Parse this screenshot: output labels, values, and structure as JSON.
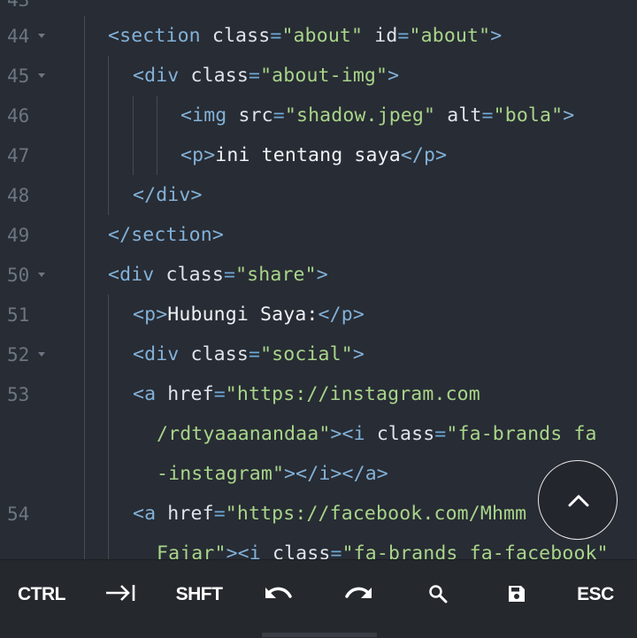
{
  "editor": {
    "top_line_number": "43",
    "lines": [
      {
        "num": "44",
        "fold": true,
        "segs": [
          [
            "t",
            "<section"
          ],
          [
            "a",
            " class"
          ],
          [
            "p",
            "="
          ],
          [
            "s",
            "\"about\""
          ],
          [
            "a",
            " id"
          ],
          [
            "p",
            "="
          ],
          [
            "s",
            "\"about\""
          ],
          [
            "t",
            ">"
          ]
        ]
      },
      {
        "num": "45",
        "fold": true,
        "segs": [
          [
            "t",
            "<div"
          ],
          [
            "a",
            " class"
          ],
          [
            "p",
            "="
          ],
          [
            "s",
            "\"about-img\""
          ],
          [
            "t",
            ">"
          ]
        ]
      },
      {
        "num": "46",
        "fold": false,
        "segs": [
          [
            "t",
            "<img"
          ],
          [
            "a",
            " src"
          ],
          [
            "p",
            "="
          ],
          [
            "s",
            "\"shadow.jpeg\""
          ],
          [
            "a",
            " alt"
          ],
          [
            "p",
            "="
          ],
          [
            "s",
            "\"bola\""
          ],
          [
            "t",
            ">"
          ]
        ]
      },
      {
        "num": "47",
        "fold": false,
        "segs": [
          [
            "t",
            "<p>"
          ],
          [
            "x",
            "ini tentang saya"
          ],
          [
            "t",
            "</p>"
          ]
        ]
      },
      {
        "num": "48",
        "fold": false,
        "segs": [
          [
            "t",
            "</div>"
          ]
        ]
      },
      {
        "num": "49",
        "fold": false,
        "segs": [
          [
            "t",
            "</section>"
          ]
        ]
      },
      {
        "num": "50",
        "fold": true,
        "segs": [
          [
            "t",
            "<div"
          ],
          [
            "a",
            " class"
          ],
          [
            "p",
            "="
          ],
          [
            "s",
            "\"share\""
          ],
          [
            "t",
            ">"
          ]
        ]
      },
      {
        "num": "51",
        "fold": false,
        "segs": [
          [
            "t",
            "<p>"
          ],
          [
            "x",
            "Hubungi Saya:"
          ],
          [
            "t",
            "</p>"
          ]
        ]
      },
      {
        "num": "52",
        "fold": true,
        "segs": [
          [
            "t",
            "<div"
          ],
          [
            "a",
            " class"
          ],
          [
            "p",
            "="
          ],
          [
            "s",
            "\"social\""
          ],
          [
            "t",
            ">"
          ]
        ]
      },
      {
        "num": "53",
        "fold": false,
        "segs": [
          [
            "t",
            "<a"
          ],
          [
            "a",
            " href"
          ],
          [
            "p",
            "="
          ],
          [
            "s",
            "\"https://instagram.com"
          ]
        ]
      },
      {
        "num": "",
        "fold": false,
        "segs": [
          [
            "s",
            "/rdtyaaanandaa\""
          ],
          [
            "t",
            "><i"
          ],
          [
            "a",
            " class"
          ],
          [
            "p",
            "="
          ],
          [
            "s",
            "\"fa-brands fa"
          ]
        ]
      },
      {
        "num": "",
        "fold": false,
        "segs": [
          [
            "s",
            "-instagram\""
          ],
          [
            "t",
            "></i></a>"
          ]
        ]
      },
      {
        "num": "54",
        "fold": false,
        "segs": [
          [
            "t",
            "<a"
          ],
          [
            "a",
            " href"
          ],
          [
            "p",
            "="
          ],
          [
            "s",
            "\"https://facebook.com/Mhmm"
          ]
        ]
      },
      {
        "num": "",
        "fold": false,
        "segs": [
          [
            "s",
            "Fajar\""
          ],
          [
            "t",
            "><i"
          ],
          [
            "a",
            " class"
          ],
          [
            "p",
            "="
          ],
          [
            "s",
            "\"fa-brands fa-facebook\""
          ]
        ]
      }
    ]
  },
  "toolbar": {
    "ctrl_label": "CTRL",
    "tab_icon": "tab-arrow-icon",
    "shift_label": "SHFT",
    "undo_icon": "undo-icon",
    "redo_icon": "redo-icon",
    "search_icon": "search-icon",
    "save_icon": "save-icon",
    "esc_label": "ESC"
  },
  "fab": {
    "icon": "chevron-up-icon"
  },
  "colors": {
    "background": "#282c34",
    "tag": "#82b1d8",
    "string": "#a8d58a",
    "attribute": "#dfe3ea",
    "gutter": "#6c7682",
    "toolbar": "#25282d"
  }
}
